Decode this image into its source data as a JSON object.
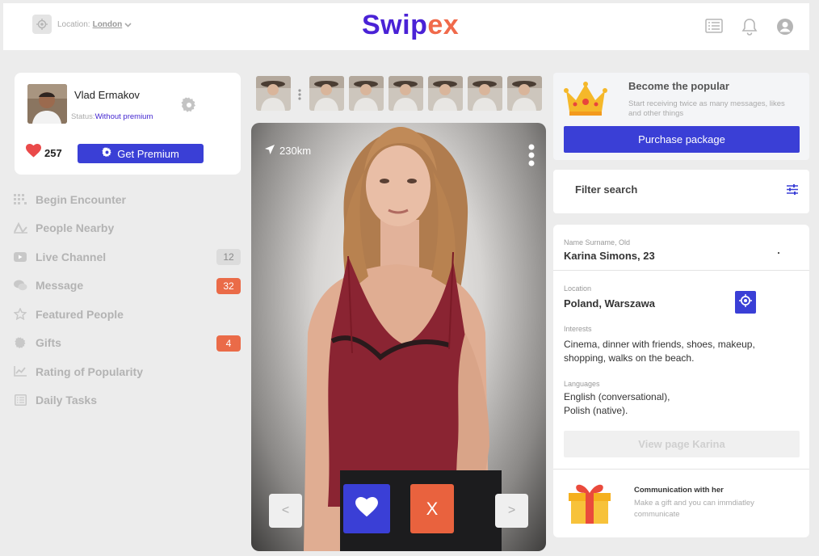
{
  "header": {
    "location_label": "Location:",
    "location_value": "London",
    "logo_part1": "Swip",
    "logo_part2": "ex",
    "icons": [
      "location-target-icon",
      "chevron-down-icon",
      "list-icon",
      "bell-icon",
      "user-icon"
    ]
  },
  "profile": {
    "name": "Vlad Ermakov",
    "status_label": "Status:",
    "status_value": "Without premium",
    "likes": "257",
    "premium_button": "Get Premium"
  },
  "nav": {
    "items": [
      {
        "label": "Begin Encounter",
        "icon": "grid-icon",
        "badge": ""
      },
      {
        "label": "People Nearby",
        "icon": "map-icon",
        "badge": ""
      },
      {
        "label": "Live Channel",
        "icon": "youtube-icon",
        "badge": "12",
        "badge_style": "gray"
      },
      {
        "label": "Message",
        "icon": "chat-icon",
        "badge": "32",
        "badge_style": "orange"
      },
      {
        "label": "Featured People",
        "icon": "star-icon",
        "badge": ""
      },
      {
        "label": "Gifts",
        "icon": "gear-icon",
        "badge": "4",
        "badge_style": "orange"
      },
      {
        "label": "Rating of Popularity",
        "icon": "chart-icon",
        "badge": ""
      },
      {
        "label": "Daily Tasks",
        "icon": "list-icon",
        "badge": ""
      }
    ]
  },
  "card": {
    "distance": "230km",
    "prev": "<",
    "next": ">",
    "skip": "X"
  },
  "popular": {
    "title": "Become the popular",
    "text": "Start receiving twice as many messages, likes and other things",
    "button": "Purchase package"
  },
  "filter": {
    "label": "Filter search"
  },
  "info": {
    "name_label": "Name Surname, Old",
    "name_value": "Karina Simons, 23",
    "location_label": "Location",
    "location_value": "Poland, Warszawa",
    "interests_label": "Interests",
    "interests_value": "Cinema, dinner with friends, shoes, makeup, shopping, walks on the beach.",
    "languages_label": "Languages",
    "languages_line1": "English (conversational),",
    "languages_line2": "Polish (native).",
    "view_button": "View page Karina",
    "comm_title": "Communication with her",
    "comm_text": "Make a gift and you can immdiatley communicate"
  },
  "colors": {
    "primary": "#3a3fd6",
    "accent": "#ea6b48",
    "logo_purple": "#4a22d6",
    "logo_orange": "#f06a4b"
  }
}
